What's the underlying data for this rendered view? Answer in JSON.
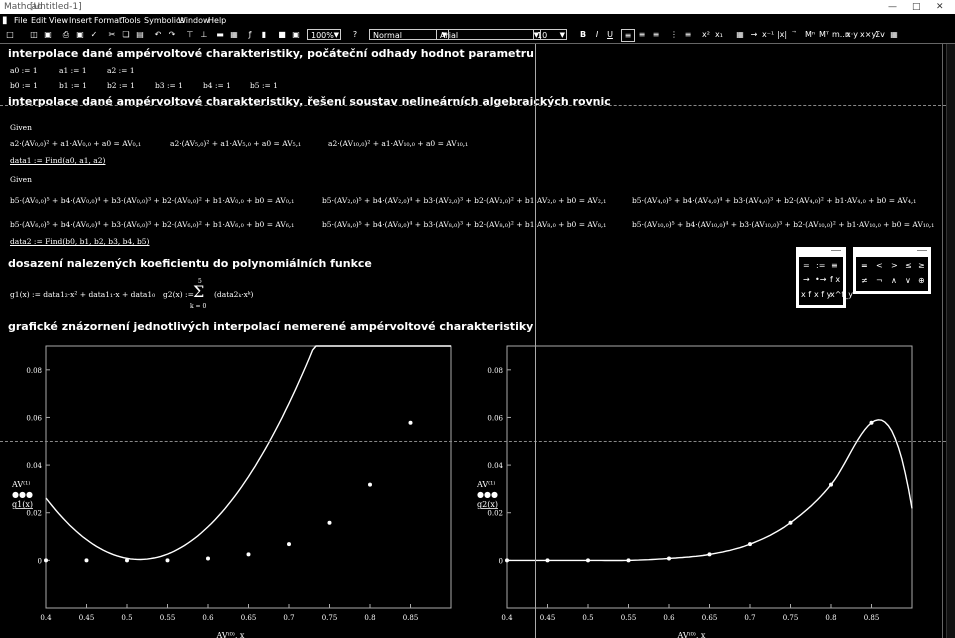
{
  "window": {
    "app": "Mathcad",
    "title": "[Untitled-1]",
    "controls": [
      "—",
      "□",
      "✕"
    ]
  },
  "menu": [
    "File",
    "Edit",
    "View",
    "Insert",
    "Format",
    "Tools",
    "Symbolics",
    "Window",
    "Help"
  ],
  "toolbar": {
    "zoom": "100%",
    "style": "Normal",
    "font": "Arial",
    "size": "10",
    "bold": "B",
    "italic": "I",
    "underline": "U"
  },
  "headings": {
    "h1": "interpolace dané ampérvoltové charakteristiky, počáteční odhady hodnot parametru",
    "h2": "interpolace dané ampérvoltové charakteristiky, řešení soustav nelineárních algebraických rovnic",
    "h3": "dosazení nalezených koeficientu do polynomiálních funkce",
    "h4": "grafické znázornení jednotlivých interpolací nemerené ampérvoltové charakteristiky"
  },
  "guesses_a": [
    "a0 := 1",
    "a1 := 1",
    "a2 := 1"
  ],
  "guesses_b": [
    "b0 := 1",
    "b1 := 1",
    "b2 := 1",
    "b3 := 1",
    "b4 := 1",
    "b5 := 1"
  ],
  "given": "Given",
  "find1": "data1 := Find(a0, a1, a2)",
  "find2": "data2 := Find(b0, b1, b2, b3, b4, b5)",
  "eq_a": [
    "a2·(AV₀,₀)² + a1·AV₀,₀ + a0 = AV₀,₁",
    "a2·(AV₅,₀)² + a1·AV₅,₀ + a0 = AV₅,₁",
    "a2·(AV₁₀,₀)² + a1·AV₁₀,₀ + a0 = AV₁₀,₁"
  ],
  "eq_b": [
    "b5·(AV₀,₀)⁵ + b4·(AV₀,₀)⁴ + b3·(AV₀,₀)³ + b2·(AV₀,₀)² + b1·AV₀,₀ + b0 = AV₀,₁",
    "b5·(AV₂,₀)⁵ + b4·(AV₂,₀)⁴ + b3·(AV₂,₀)³ + b2·(AV₂,₀)² + b1·AV₂,₀ + b0 = AV₂,₁",
    "b5·(AV₄,₀)⁵ + b4·(AV₄,₀)⁴ + b3·(AV₄,₀)³ + b2·(AV₄,₀)² + b1·AV₄,₀ + b0 = AV₄,₁",
    "b5·(AV₆,₀)⁵ + b4·(AV₆,₀)⁴ + b3·(AV₆,₀)³ + b2·(AV₆,₀)² + b1·AV₆,₀ + b0 = AV₆,₁",
    "b5·(AV₈,₀)⁵ + b4·(AV₈,₀)⁴ + b3·(AV₈,₀)³ + b2·(AV₈,₀)² + b1·AV₈,₀ + b0 = AV₈,₁",
    "b5·(AV₁₀,₀)⁵ + b4·(AV₁₀,₀)⁴ + b3·(AV₁₀,₀)³ + b2·(AV₁₀,₀)² + b1·AV₁₀,₀ + b0 = AV₁₀,₁"
  ],
  "g1_def": "g1(x) := data1₂·x² + data1₁·x + data1₀",
  "g2_lhs": "g2(x) :=",
  "g2_sum": "Σ",
  "g2_upper": "5",
  "g2_lower": "k = 0",
  "g2_body": "(data2ₖ·xᵏ)",
  "palette1": [
    "=",
    ":=",
    "≡",
    "→",
    "•→",
    "f x",
    "x f",
    "x f y",
    "x^f_y"
  ],
  "palette2": [
    "=",
    "<",
    ">",
    "≤",
    "≥",
    "≠",
    "¬",
    "∧",
    "∨",
    "⊕"
  ],
  "chart_data": [
    {
      "type": "scatter",
      "xticks": [
        "0.4",
        "0.45",
        "0.5",
        "0.55",
        "0.6",
        "0.65",
        "0.7",
        "0.75",
        "0.8",
        "0.85"
      ],
      "yticks": [
        "0",
        "0.02",
        "0.04",
        "0.06",
        "0.08"
      ],
      "xlim": [
        0.4,
        0.9
      ],
      "ylim": [
        -0.02,
        0.09
      ],
      "xlabel": "AV⁽⁰⁾, x",
      "ylabel_top": "AV⁽¹⁾",
      "ylabel_bottom": "g1(x)",
      "points_x": [
        0.4,
        0.45,
        0.5,
        0.55,
        0.6,
        0.65,
        0.7,
        0.75,
        0.8,
        0.85
      ],
      "points_y": [
        0.0,
        0.0,
        0.0,
        0.0,
        0.0008,
        0.0025,
        0.0068,
        0.0158,
        0.0318,
        0.0578
      ],
      "curve_coef": [
        0.5134,
        -1.9897,
        1.9292
      ]
    },
    {
      "type": "scatter",
      "xticks": [
        "0.4",
        "0.45",
        "0.5",
        "0.55",
        "0.6",
        "0.65",
        "0.7",
        "0.75",
        "0.8",
        "0.85"
      ],
      "yticks": [
        "0",
        "0.02",
        "0.04",
        "0.06",
        "0.08"
      ],
      "xlim": [
        0.4,
        0.9
      ],
      "ylim": [
        -0.02,
        0.09
      ],
      "xlabel": "AV⁽⁰⁾, x",
      "ylabel_top": "AV⁽¹⁾",
      "ylabel_bottom": "g2(x)",
      "points_x": [
        0.4,
        0.45,
        0.5,
        0.55,
        0.6,
        0.65,
        0.7,
        0.75,
        0.8,
        0.85
      ],
      "points_y": [
        0.0,
        0.0,
        0.0,
        0.0,
        0.0008,
        0.0025,
        0.0068,
        0.0158,
        0.0318,
        0.0578
      ]
    }
  ]
}
